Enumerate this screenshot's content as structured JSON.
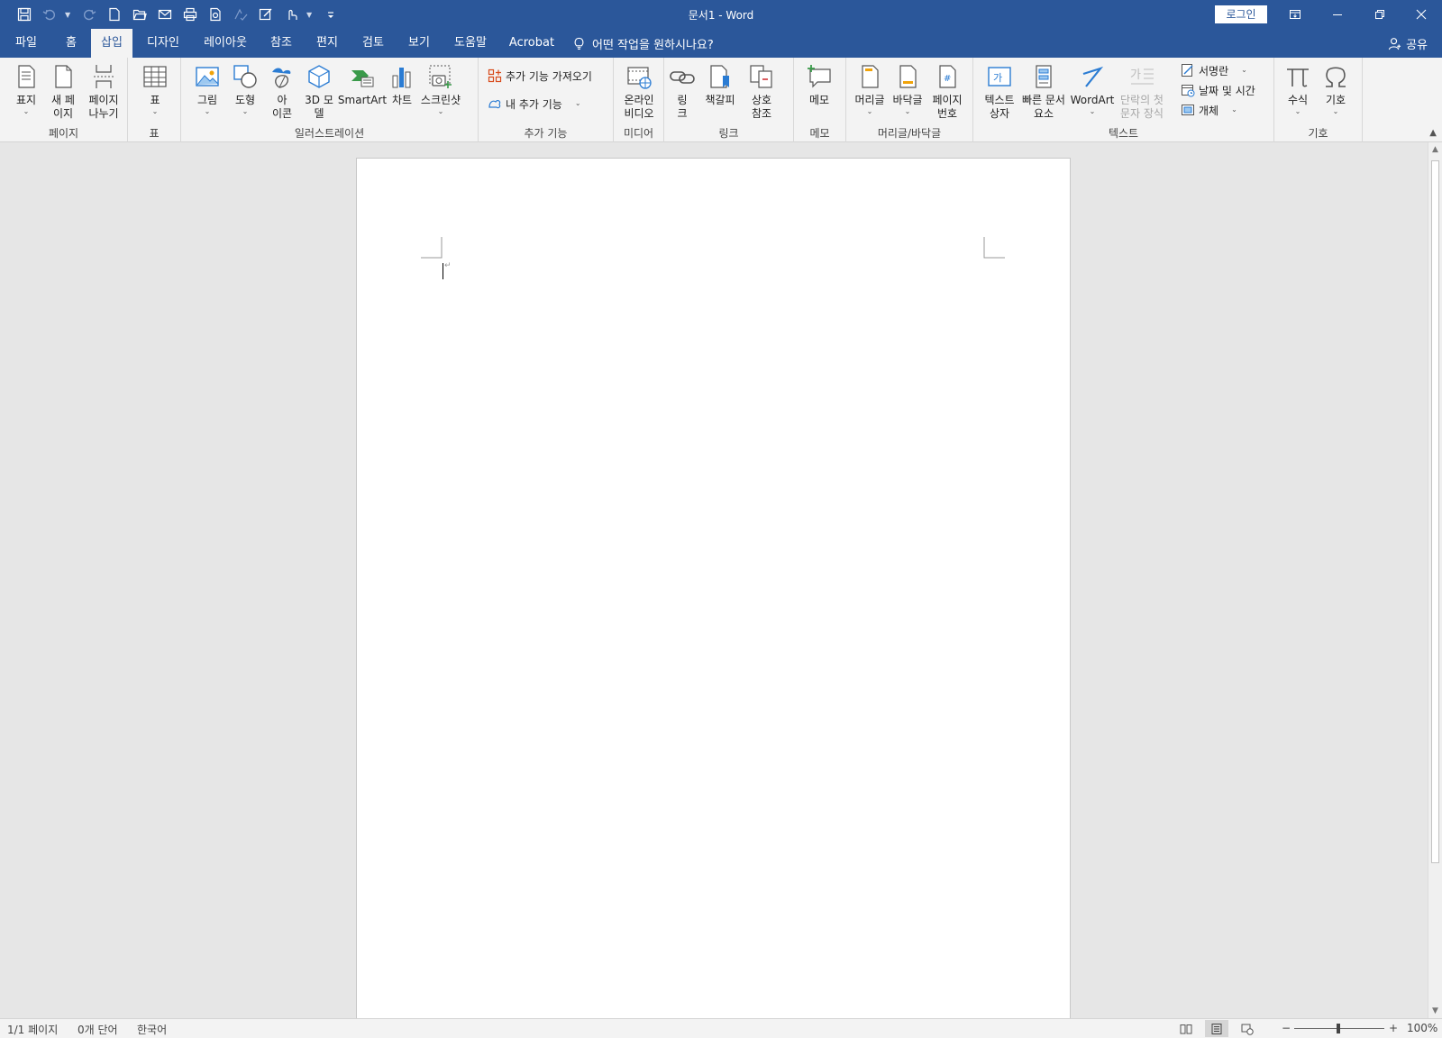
{
  "window": {
    "title": "문서1  -  Word",
    "login_label": "로그인"
  },
  "tabs": [
    {
      "label": "파일"
    },
    {
      "label": "홈"
    },
    {
      "label": "삽입",
      "active": true
    },
    {
      "label": "디자인"
    },
    {
      "label": "레이아웃"
    },
    {
      "label": "참조"
    },
    {
      "label": "편지"
    },
    {
      "label": "검토"
    },
    {
      "label": "보기"
    },
    {
      "label": "도움말"
    },
    {
      "label": "Acrobat"
    }
  ],
  "tell_me": "어떤 작업을 원하시나요?",
  "share": "공유",
  "ribbon": {
    "pages": {
      "label": "페이지",
      "cover": "표지",
      "blank": "새 페\n이지",
      "break": "페이지\n나누기"
    },
    "tables": {
      "label": "표",
      "table": "표"
    },
    "illustrations": {
      "label": "일러스트레이션",
      "picture": "그림",
      "shapes": "도형",
      "icons": "아\n이콘",
      "model3d": "3D 모\n델",
      "smartart": "SmartArt",
      "chart": "차트",
      "screenshot": "스크린샷"
    },
    "addins": {
      "label": "추가 기능",
      "get": "추가 기능 가져오기",
      "my": "내 추가 기능"
    },
    "media": {
      "label": "미디어",
      "video": "온라인\n비디오"
    },
    "links": {
      "label": "링크",
      "link": "링\n크",
      "bookmark": "책갈피",
      "crossref": "상호\n참조"
    },
    "comments": {
      "label": "메모",
      "comment": "메모"
    },
    "headerfooter": {
      "label": "머리글/바닥글",
      "header": "머리글",
      "footer": "바닥글",
      "pagenum": "페이지\n번호"
    },
    "text": {
      "label": "텍스트",
      "textbox": "텍스트\n상자",
      "quickparts": "빠른 문서\n요소",
      "wordart": "WordArt",
      "dropcap": "단락의 첫\n문자 장식",
      "signature": "서명란",
      "datetime": "날짜 및 시간",
      "object": "개체"
    },
    "symbols": {
      "label": "기호",
      "equation": "수식",
      "symbol": "기호"
    }
  },
  "status": {
    "page": "1/1 페이지",
    "words": "0개 단어",
    "language": "한국어",
    "zoom": "100%",
    "zoom_minus": "−",
    "zoom_plus": "+"
  },
  "colors": {
    "brand": "#2b579a",
    "ribbon": "#f3f3f3",
    "canvas": "#e6e6e6"
  }
}
